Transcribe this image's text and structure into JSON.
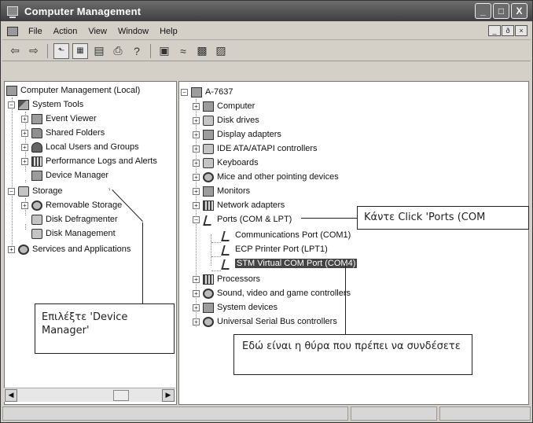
{
  "window": {
    "title": "Computer Management",
    "controls": {
      "minimize": "_",
      "maximize": "□",
      "close": "X"
    }
  },
  "menubar": {
    "items": [
      "File",
      "Action",
      "View",
      "Window",
      "Help"
    ],
    "mdi_controls": {
      "minimize": "_",
      "restore": "ð",
      "close": "×"
    }
  },
  "toolbar": {
    "icons": [
      "back-arrow-icon",
      "forward-arrow-icon",
      "up-folder-icon",
      "show-hide-tree-icon",
      "properties-icon",
      "print-icon",
      "help-icon",
      "console-icon",
      "scan-hardware-icon",
      "disable-device-icon",
      "uninstall-device-icon"
    ]
  },
  "left_tree": {
    "items": [
      {
        "label": "Computer Management (Local)"
      },
      {
        "label": "System Tools"
      },
      {
        "label": "Event Viewer"
      },
      {
        "label": "Shared Folders"
      },
      {
        "label": "Local Users and Groups"
      },
      {
        "label": "Performance Logs and Alerts"
      },
      {
        "label": "Device Manager"
      },
      {
        "label": "Storage"
      },
      {
        "label": "Removable Storage"
      },
      {
        "label": "Disk Defragmenter"
      },
      {
        "label": "Disk Management"
      },
      {
        "label": "Services and Applications"
      }
    ]
  },
  "right_tree": {
    "root": "A-7637",
    "items": [
      {
        "label": "Computer"
      },
      {
        "label": "Disk drives"
      },
      {
        "label": "Display adapters"
      },
      {
        "label": "IDE ATA/ATAPI controllers"
      },
      {
        "label": "Keyboards"
      },
      {
        "label": "Mice and other pointing devices"
      },
      {
        "label": "Monitors"
      },
      {
        "label": "Network adapters"
      },
      {
        "label": "Ports (COM & LPT)"
      },
      {
        "label": "Communications Port (COM1)"
      },
      {
        "label": "ECP Printer Port (LPT1)"
      },
      {
        "label": "STM Virtual COM Port (COM4)"
      },
      {
        "label": "Processors"
      },
      {
        "label": "Sound, video and game controllers"
      },
      {
        "label": "System devices"
      },
      {
        "label": "Universal Serial Bus controllers"
      }
    ]
  },
  "callouts": {
    "select_device_manager": "Επιλέξτε 'Device Manager'",
    "click_ports": "Κάντε Click 'Ports (COM",
    "port_to_connect": "Εδώ είναι η θύρα που πρέπει να συνδέσετε"
  },
  "colors": {
    "titlebar": "#4a4a4a",
    "selection": "#444444",
    "window_bg": "#d4d0c8"
  }
}
